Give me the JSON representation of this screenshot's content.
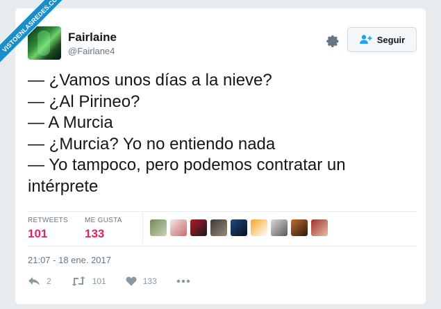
{
  "watermark": "VISTOENLASREDES.COM",
  "user": {
    "name": "Fairlaine",
    "handle": "@Fairlane4"
  },
  "follow_label": "Seguir",
  "tweet_lines": [
    "— ¿Vamos unos días a la nieve?",
    "— ¿Al Pirineo?",
    "— A Murcia",
    "— ¿Murcia? Yo no entiendo nada",
    "— Yo tampoco, pero podemos contratar un",
    "intérprete"
  ],
  "stats": {
    "retweets_label": "RETWEETS",
    "retweets_value": "101",
    "likes_label": "ME GUSTA",
    "likes_value": "133"
  },
  "liker_avatars": [
    {
      "colors": [
        "#6f8a5a",
        "#c9d3b8"
      ]
    },
    {
      "colors": [
        "#f2e6e6",
        "#c96b6b"
      ]
    },
    {
      "colors": [
        "#b01d2a",
        "#1a1a1a"
      ]
    },
    {
      "colors": [
        "#3a3a3a",
        "#9a8a7a"
      ]
    },
    {
      "colors": [
        "#1f4a7a",
        "#0b0f20"
      ]
    },
    {
      "colors": [
        "#f5a623",
        "#ffffff"
      ]
    },
    {
      "colors": [
        "#d9d9d9",
        "#5a5a5a"
      ]
    },
    {
      "colors": [
        "#c46a2a",
        "#2a1a10"
      ]
    },
    {
      "colors": [
        "#a03030",
        "#e6c0a0"
      ]
    }
  ],
  "timestamp": "21:07 - 18 ene. 2017",
  "actions": {
    "reply_count": "2",
    "retweet_count": "101",
    "like_count": "133"
  },
  "colors": {
    "accent": "#e0245e",
    "muted": "#657786",
    "watermark": "#1b8ec9"
  }
}
